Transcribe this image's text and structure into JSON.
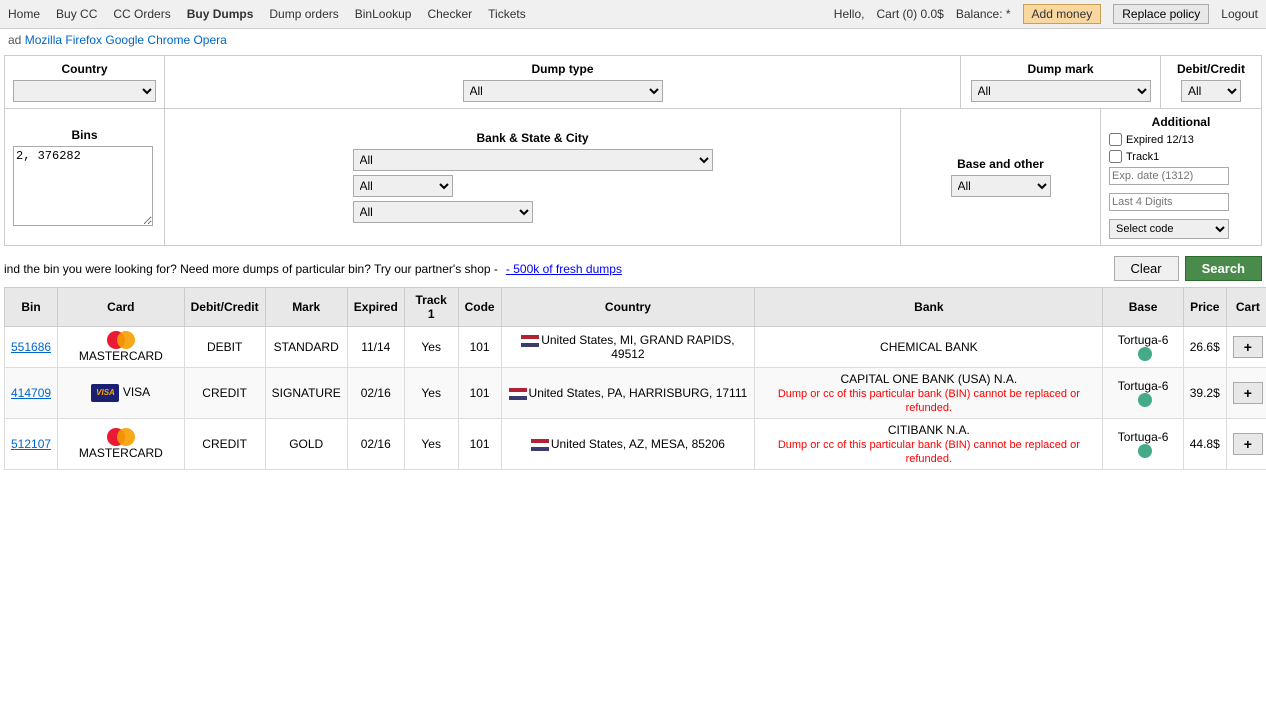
{
  "nav": {
    "items": [
      {
        "label": "Home",
        "active": false
      },
      {
        "label": "Buy CC",
        "active": false
      },
      {
        "label": "CC Orders",
        "active": false
      },
      {
        "label": "Buy Dumps",
        "active": true
      },
      {
        "label": "Dump orders",
        "active": false
      },
      {
        "label": "BinLookup",
        "active": false
      },
      {
        "label": "Checker",
        "active": false
      },
      {
        "label": "Tickets",
        "active": false
      }
    ],
    "hello": "Hello,",
    "cart": "Cart (0) 0.0$",
    "balance": "Balance: *",
    "addmoney": "Add money",
    "replacepolicy": "Replace policy",
    "logout": "Logout"
  },
  "downloadbar": {
    "prefix": "ad",
    "links": [
      "Mozilla Firefox",
      "Google Chrome",
      "Opera"
    ]
  },
  "filters": {
    "country_label": "Country",
    "dumptype_label": "Dump type",
    "dumptype_value": "All",
    "dumpmark_label": "Dump mark",
    "dumpmark_value": "All",
    "debitcredit_label": "Debit/Credit",
    "debitcredit_value": "All",
    "bins_label": "Bins",
    "bins_value": "2, 376282",
    "bankstate_label": "Bank & State & City",
    "bankstate_value1": "All",
    "bankstate_value2": "All",
    "bankstate_value3": "All",
    "baseother_label": "Base and other",
    "baseother_value": "All",
    "additional_label": "Additional",
    "expired_label": "Expired 12/13",
    "track1_label": "Track1",
    "expdate_placeholder": "Exp. date (1312)",
    "lastdigits_placeholder": "Last 4 Digits",
    "selectcode_label": "Select code"
  },
  "partner": {
    "text": "ind the bin you were looking for? Need more dumps of particular bin? Try our partner's shop -",
    "link": "- 500k of fresh dumps"
  },
  "buttons": {
    "clear": "Clear",
    "search": "Search"
  },
  "table": {
    "headers": [
      "Bin",
      "Card",
      "Debit/Credit",
      "Mark",
      "Expired",
      "Track 1",
      "Code",
      "Country",
      "Bank",
      "Base",
      "Price",
      "Cart"
    ],
    "rows": [
      {
        "bin": "551686",
        "card_type": "mastercard",
        "card_label": "MASTERCARD",
        "debitcredit": "DEBIT",
        "mark": "STANDARD",
        "expired": "11/14",
        "track1": "Yes",
        "code": "101",
        "flag": "us",
        "country": "United States, MI, GRAND RAPIDS, 49512",
        "bank": "CHEMICAL BANK",
        "bank_warning": "",
        "base": "Tortuga-6",
        "price": "26.6$",
        "has_dot": true
      },
      {
        "bin": "414709",
        "card_type": "visa",
        "card_label": "VISA",
        "debitcredit": "CREDIT",
        "mark": "SIGNATURE",
        "expired": "02/16",
        "track1": "Yes",
        "code": "101",
        "flag": "us",
        "country": "United States, PA, HARRISBURG, 17111",
        "bank": "CAPITAL ONE BANK (USA) N.A.",
        "bank_warning": "Dump or cc of this particular bank (BIN) cannot be replaced or refunded.",
        "base": "Tortuga-6",
        "price": "39.2$",
        "has_dot": true
      },
      {
        "bin": "512107",
        "card_type": "mastercard",
        "card_label": "MASTERCARD",
        "debitcredit": "CREDIT",
        "mark": "GOLD",
        "expired": "02/16",
        "track1": "Yes",
        "code": "101",
        "flag": "us",
        "country": "United States, AZ, MESA, 85206",
        "bank": "CITIBANK N.A.",
        "bank_warning": "Dump or cc of this particular bank (BIN) cannot be replaced or refunded.",
        "base": "Tortuga-6",
        "price": "44.8$",
        "has_dot": true
      }
    ]
  }
}
